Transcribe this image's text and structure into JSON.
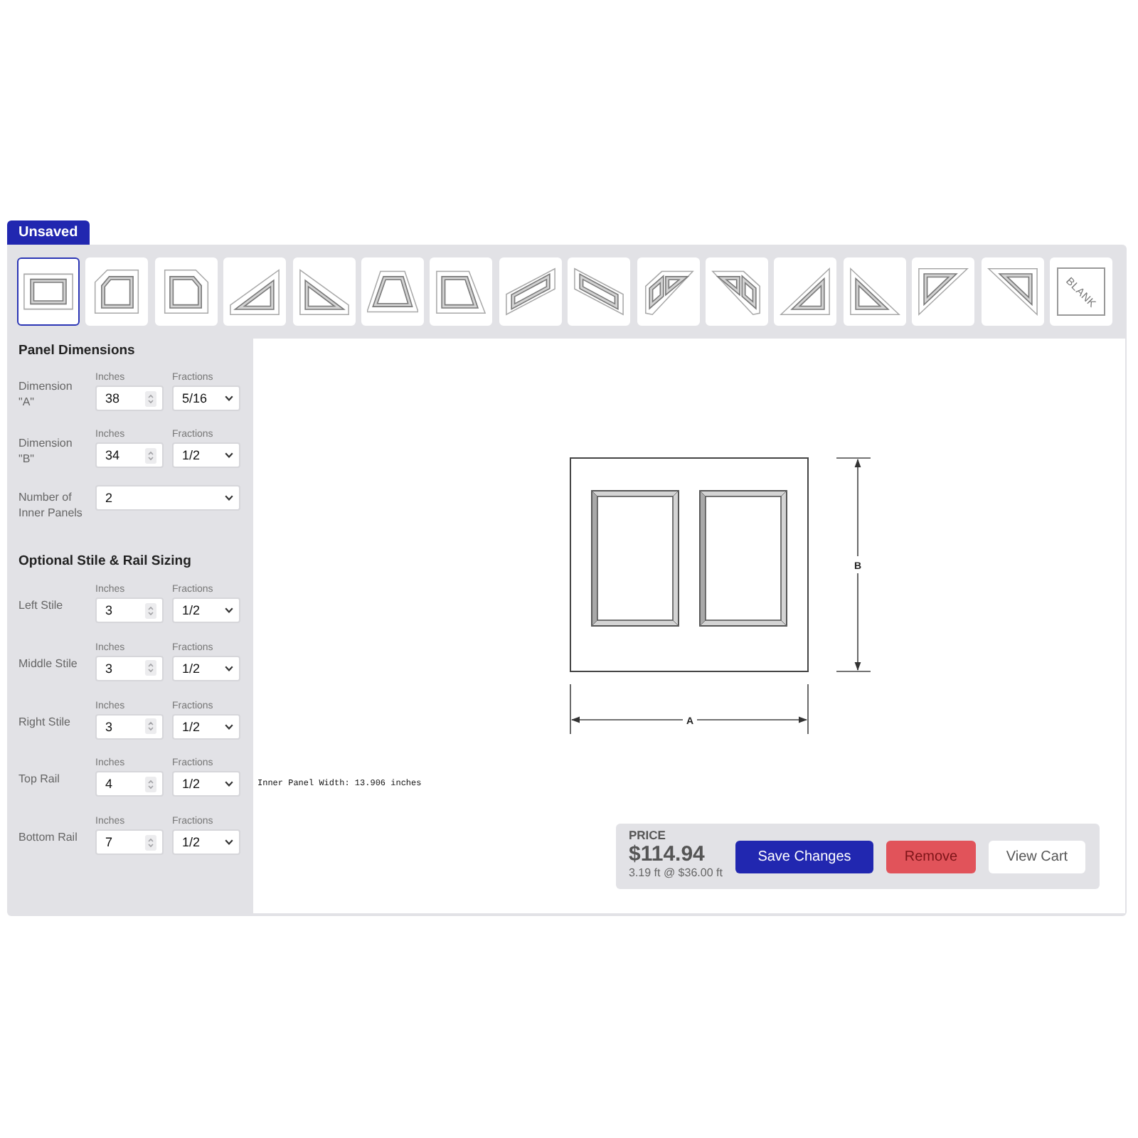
{
  "tab": {
    "label": "Unsaved"
  },
  "shapes": [
    {
      "kind": "rectangle",
      "selected": true
    },
    {
      "kind": "clipped-left",
      "selected": false
    },
    {
      "kind": "clipped-right",
      "selected": false
    },
    {
      "kind": "triangle-rise",
      "selected": false
    },
    {
      "kind": "triangle-fall",
      "selected": false
    },
    {
      "kind": "trapezoid",
      "selected": false
    },
    {
      "kind": "trapezoid-right",
      "selected": false
    },
    {
      "kind": "parallelogram-rise",
      "selected": false
    },
    {
      "kind": "parallelogram-fall",
      "selected": false
    },
    {
      "kind": "split-rise",
      "selected": false
    },
    {
      "kind": "split-fall",
      "selected": false
    },
    {
      "kind": "right-triangle-right",
      "selected": false
    },
    {
      "kind": "right-triangle-left",
      "selected": false
    },
    {
      "kind": "inverted-triangle-left",
      "selected": false
    },
    {
      "kind": "inverted-triangle-right",
      "selected": false
    },
    {
      "kind": "blank",
      "label": "BLANK",
      "selected": false
    }
  ],
  "panel_dimensions": {
    "title": "Panel Dimensions",
    "rows": [
      {
        "label": "Dimension \"A\"",
        "inches_caption": "Inches",
        "inches": "38",
        "fractions_caption": "Fractions",
        "fraction": "5/16"
      },
      {
        "label": "Dimension \"B\"",
        "inches_caption": "Inches",
        "inches": "34",
        "fractions_caption": "Fractions",
        "fraction": "1/2"
      }
    ],
    "inner_panels": {
      "label": "Number of Inner Panels",
      "value": "2"
    }
  },
  "stile_rail": {
    "title": "Optional Stile & Rail Sizing",
    "rows": [
      {
        "label": "Left Stile",
        "inches_caption": "Inches",
        "inches": "3",
        "fractions_caption": "Fractions",
        "fraction": "1/2"
      },
      {
        "label": "Middle Stile",
        "inches_caption": "Inches",
        "inches": "3",
        "fractions_caption": "Fractions",
        "fraction": "1/2"
      },
      {
        "label": "Right Stile",
        "inches_caption": "Inches",
        "inches": "3",
        "fractions_caption": "Fractions",
        "fraction": "1/2"
      },
      {
        "label": "Top Rail",
        "inches_caption": "Inches",
        "inches": "4",
        "fractions_caption": "Fractions",
        "fraction": "1/2"
      },
      {
        "label": "Bottom Rail",
        "inches_caption": "Inches",
        "inches": "7",
        "fractions_caption": "Fractions",
        "fraction": "1/2"
      }
    ]
  },
  "drawing": {
    "width_label": "A",
    "height_label": "B",
    "note": "Inner Panel Width: 13.906 inches"
  },
  "price": {
    "label": "PRICE",
    "amount": "$114.94",
    "detail": "3.19 ft @ $36.00 ft"
  },
  "buttons": [
    {
      "kind": "primary",
      "label": "Save Changes"
    },
    {
      "kind": "danger",
      "label": "Remove"
    },
    {
      "kind": "plain",
      "label": "View Cart"
    }
  ]
}
